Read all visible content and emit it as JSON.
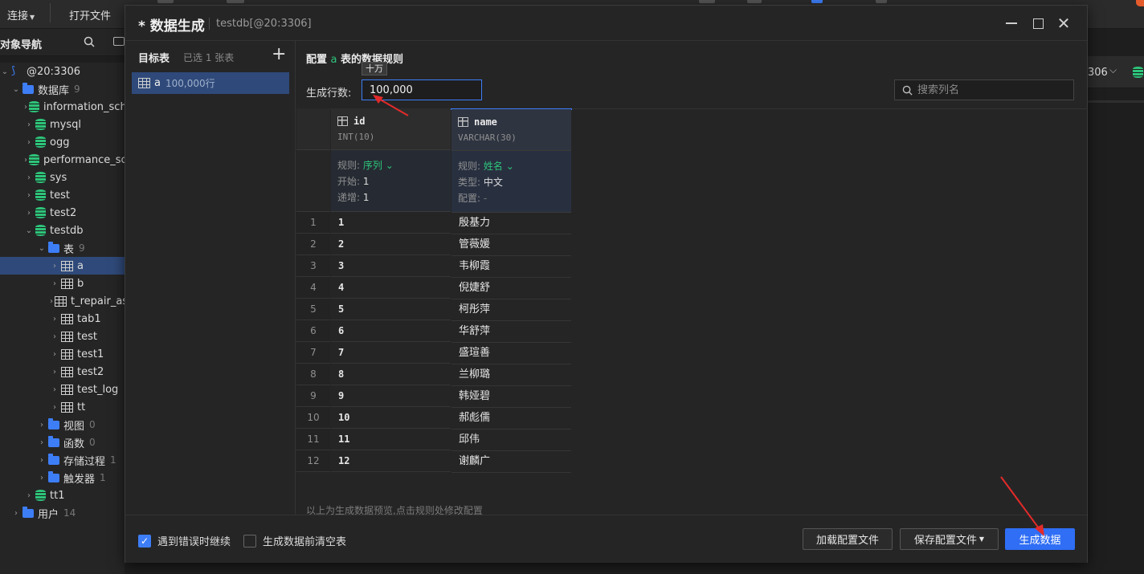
{
  "toolbar": {
    "connect_label": "连接",
    "open_file_label": "打开文件"
  },
  "nav": {
    "title": "对象导航",
    "tree": [
      {
        "label": "@20:3306",
        "kind": "connection",
        "level": 0,
        "expanded": true
      },
      {
        "label": "数据库",
        "count": "9",
        "kind": "folder",
        "level": 1,
        "expanded": true
      },
      {
        "label": "information_schema",
        "kind": "db",
        "level": 2
      },
      {
        "label": "mysql",
        "kind": "db",
        "level": 2
      },
      {
        "label": "ogg",
        "kind": "db",
        "level": 2
      },
      {
        "label": "performance_schema",
        "kind": "db",
        "level": 2
      },
      {
        "label": "sys",
        "kind": "db",
        "level": 2
      },
      {
        "label": "test",
        "kind": "db",
        "level": 2
      },
      {
        "label": "test2",
        "kind": "db",
        "level": 2
      },
      {
        "label": "testdb",
        "kind": "db",
        "level": 2,
        "expanded": true
      },
      {
        "label": "表",
        "count": "9",
        "kind": "folder",
        "level": 3,
        "expanded": true
      },
      {
        "label": "a",
        "kind": "table",
        "level": 4,
        "selected": true
      },
      {
        "label": "b",
        "kind": "table",
        "level": 4
      },
      {
        "label": "t_repair_assist",
        "kind": "table",
        "level": 4
      },
      {
        "label": "tab1",
        "kind": "table",
        "level": 4
      },
      {
        "label": "test",
        "kind": "table",
        "level": 4
      },
      {
        "label": "test1",
        "kind": "table",
        "level": 4
      },
      {
        "label": "test2",
        "kind": "table",
        "level": 4
      },
      {
        "label": "test_log",
        "kind": "table",
        "level": 4
      },
      {
        "label": "tt",
        "kind": "table",
        "level": 4
      },
      {
        "label": "视图",
        "count": "0",
        "kind": "folder",
        "level": 3
      },
      {
        "label": "函数",
        "count": "0",
        "kind": "folder",
        "level": 3
      },
      {
        "label": "存储过程",
        "count": "1",
        "kind": "folder",
        "level": 3
      },
      {
        "label": "触发器",
        "count": "1",
        "kind": "folder",
        "level": 3
      },
      {
        "label": "tt1",
        "kind": "db",
        "level": 2
      },
      {
        "label": "用户",
        "count": "14",
        "kind": "folder",
        "level": 1
      }
    ]
  },
  "background": {
    "port_label": "306"
  },
  "dialog": {
    "title": "* 数据生成",
    "subtitle": "testdb[@20:3306]",
    "left": {
      "title": "目标表",
      "selected_count": "已选 1 张表",
      "add_symbol": "+",
      "tables": [
        {
          "name": "a",
          "rows": "100,000行"
        }
      ]
    },
    "config": {
      "title_prefix": "配置 ",
      "table_name": "a",
      "title_suffix": " 表的数据规则",
      "rows_label": "生成行数:",
      "rows_value": "100,000",
      "rows_tooltip": "十万",
      "search_placeholder": "搜索列名"
    },
    "columns": [
      {
        "name": "id",
        "type": "INT(10)",
        "rule_key": "规则:",
        "rule_value": "序列",
        "p1_key": "开始:",
        "p1_value": "1",
        "p2_key": "递增:",
        "p2_value": "1",
        "values": [
          "1",
          "2",
          "3",
          "4",
          "5",
          "6",
          "7",
          "8",
          "9",
          "10",
          "11",
          "12"
        ]
      },
      {
        "name": "name",
        "type": "VARCHAR(30)",
        "rule_key": "规则:",
        "rule_value": "姓名",
        "p1_key": "类型:",
        "p1_value": "中文",
        "p2_key": "配置:",
        "p2_value": "-",
        "values": [
          "殷基力",
          "管薇媛",
          "韦柳霞",
          "倪婕舒",
          "柯彤萍",
          "华舒萍",
          "盛瑄善",
          "兰柳璐",
          "韩娅碧",
          "郝彪儒",
          "邱伟",
          "谢麟广"
        ]
      }
    ],
    "row_numbers": [
      "1",
      "2",
      "3",
      "4",
      "5",
      "6",
      "7",
      "8",
      "9",
      "10",
      "11",
      "12"
    ],
    "preview_note": "以上为生成数据预览,点击规则处修改配置",
    "footer": {
      "continue_on_error": "遇到错误时继续",
      "continue_on_error_checked": true,
      "truncate_before": "生成数据前清空表",
      "truncate_before_checked": false,
      "load_config": "加载配置文件",
      "save_config": "保存配置文件",
      "generate": "生成数据"
    }
  },
  "colors": {
    "accent_blue": "#2f6ef5",
    "accent_green": "#2ec47a",
    "annotation_red": "#e32a2a"
  }
}
